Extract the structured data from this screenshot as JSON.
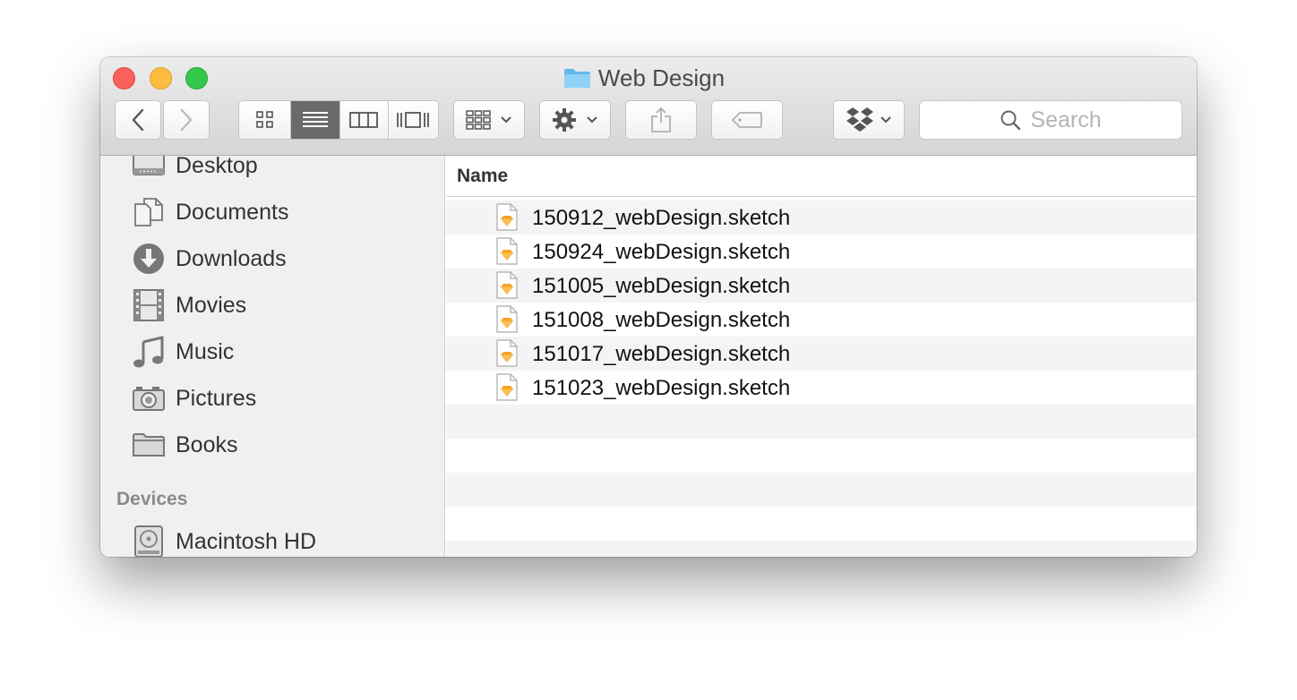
{
  "window": {
    "title": "Web Design"
  },
  "toolbar": {
    "back_icon": "chevron-left-icon",
    "forward_icon": "chevron-right-icon",
    "view_modes": [
      "icon-view-icon",
      "list-view-icon",
      "column-view-icon",
      "cover-flow-icon"
    ],
    "active_view": "list",
    "arrange_icon": "arrange-grid-icon",
    "action_icon": "gear-icon",
    "share_icon": "share-icon",
    "tag_icon": "tag-icon",
    "dropbox_icon": "dropbox-icon",
    "search_placeholder": "Search"
  },
  "sidebar": {
    "items": [
      {
        "label": "Desktop",
        "icon": "desktop-icon"
      },
      {
        "label": "Documents",
        "icon": "documents-icon"
      },
      {
        "label": "Downloads",
        "icon": "download-icon"
      },
      {
        "label": "Movies",
        "icon": "film-icon"
      },
      {
        "label": "Music",
        "icon": "music-note-icon"
      },
      {
        "label": "Pictures",
        "icon": "camera-icon"
      },
      {
        "label": "Books",
        "icon": "folder-icon"
      }
    ],
    "devices_heading": "Devices",
    "devices": [
      {
        "label": "Macintosh HD",
        "icon": "hard-drive-icon"
      }
    ]
  },
  "main": {
    "column_header": "Name",
    "files": [
      {
        "name": "150912_webDesign.sketch",
        "icon": "sketch-file-icon"
      },
      {
        "name": "150924_webDesign.sketch",
        "icon": "sketch-file-icon"
      },
      {
        "name": "151005_webDesign.sketch",
        "icon": "sketch-file-icon"
      },
      {
        "name": "151008_webDesign.sketch",
        "icon": "sketch-file-icon"
      },
      {
        "name": "151017_webDesign.sketch",
        "icon": "sketch-file-icon"
      },
      {
        "name": "151023_webDesign.sketch",
        "icon": "sketch-file-icon"
      }
    ]
  },
  "colors": {
    "close": "#fc605c",
    "minimize": "#fdbc40",
    "maximize": "#34c84a",
    "folder_blue": "#6cc0f0",
    "sketch_orange": "#f7a325"
  }
}
